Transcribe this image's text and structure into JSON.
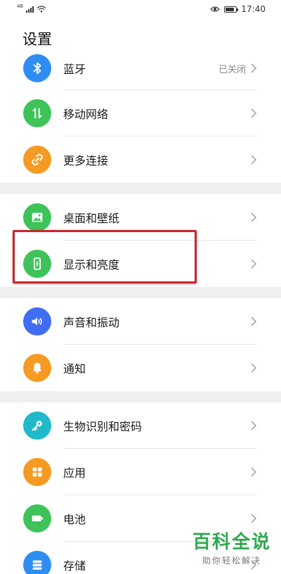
{
  "status_bar": {
    "network_type": "46",
    "time": "17:40",
    "battery_level": 0.85,
    "icons": [
      "signal-icon",
      "wifi-icon",
      "eye-comfort-icon",
      "battery-icon"
    ]
  },
  "page": {
    "title": "设置"
  },
  "groups": [
    {
      "items": [
        {
          "label": "蓝牙",
          "value": "已关闭",
          "icon": "bluetooth-icon",
          "color": "#2f8df2"
        },
        {
          "label": "移动网络",
          "value": "",
          "icon": "mobile-data-icon",
          "color": "#3ec35a"
        },
        {
          "label": "更多连接",
          "value": "",
          "icon": "link-icon",
          "color": "#f59a22"
        }
      ]
    },
    {
      "items": [
        {
          "label": "桌面和壁纸",
          "value": "",
          "icon": "wallpaper-icon",
          "color": "#3ec35a"
        },
        {
          "label": "显示和亮度",
          "value": "",
          "icon": "display-icon",
          "color": "#3ec35a"
        }
      ]
    },
    {
      "items": [
        {
          "label": "声音和振动",
          "value": "",
          "icon": "sound-icon",
          "color": "#3f6ef2"
        },
        {
          "label": "通知",
          "value": "",
          "icon": "bell-icon",
          "color": "#f59a22"
        }
      ]
    },
    {
      "items": [
        {
          "label": "生物识别和密码",
          "value": "",
          "icon": "key-icon",
          "color": "#1fb9c9"
        },
        {
          "label": "应用",
          "value": "",
          "icon": "apps-icon",
          "color": "#f59a22"
        },
        {
          "label": "电池",
          "value": "",
          "icon": "battery-icon",
          "color": "#3ec35a"
        },
        {
          "label": "存储",
          "value": "",
          "icon": "storage-icon",
          "color": "#2f8df2"
        }
      ]
    }
  ],
  "annotation": {
    "highlighted_item": "显示和亮度",
    "color": "#c8262b"
  },
  "watermark": {
    "title": "百科全说",
    "subtitle": "助你轻松解决",
    "color": "#2ea84f"
  }
}
